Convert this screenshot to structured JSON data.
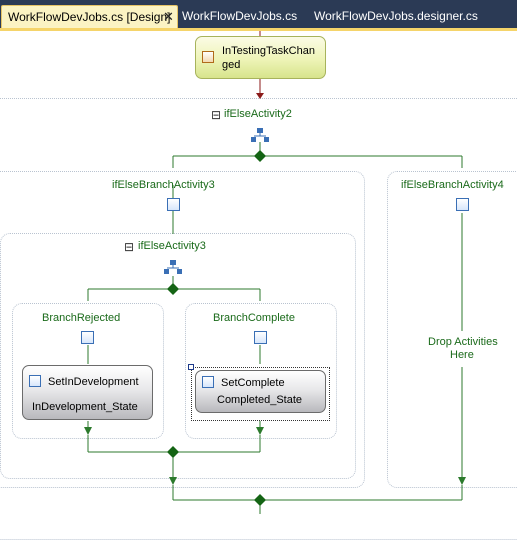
{
  "tabs": [
    {
      "label": "WorkFlowDevJobs.cs [Design]",
      "active": true
    },
    {
      "label": "WorkFlowDevJobs.cs",
      "active": false
    },
    {
      "label": "WorkFlowDevJobs.designer.cs",
      "active": false
    }
  ],
  "tab_close_glyph": "✕",
  "colors": {
    "tabbar": "#2b3a55",
    "accent": "#f5d46a",
    "wire": "#2c7a2c",
    "label": "#1a6a1a",
    "incoming_arrow": "#8b1a1a"
  },
  "workflow": {
    "code_activity": {
      "label": "InTestingTaskChanged",
      "line1": "InTestingTaskChan",
      "line2": "ged",
      "icon": "code-activity-icon"
    },
    "if_else_outer": {
      "label": "ifElseActivity2",
      "collapse": "⊟"
    },
    "branch_left": {
      "label": "ifElseBranchActivity3"
    },
    "branch_right": {
      "label": "ifElseBranchActivity4",
      "drop_line1": "Drop Activities",
      "drop_line2": "Here"
    },
    "if_else_inner": {
      "label": "ifElseActivity3",
      "collapse": "⊟"
    },
    "branch_rejected": {
      "label": "BranchRejected",
      "activity_name": "SetInDevelopment",
      "activity_state": "InDevelopment_State"
    },
    "branch_complete": {
      "label": "BranchComplete",
      "activity_name": "SetComplete",
      "activity_state": "Completed_State"
    }
  }
}
